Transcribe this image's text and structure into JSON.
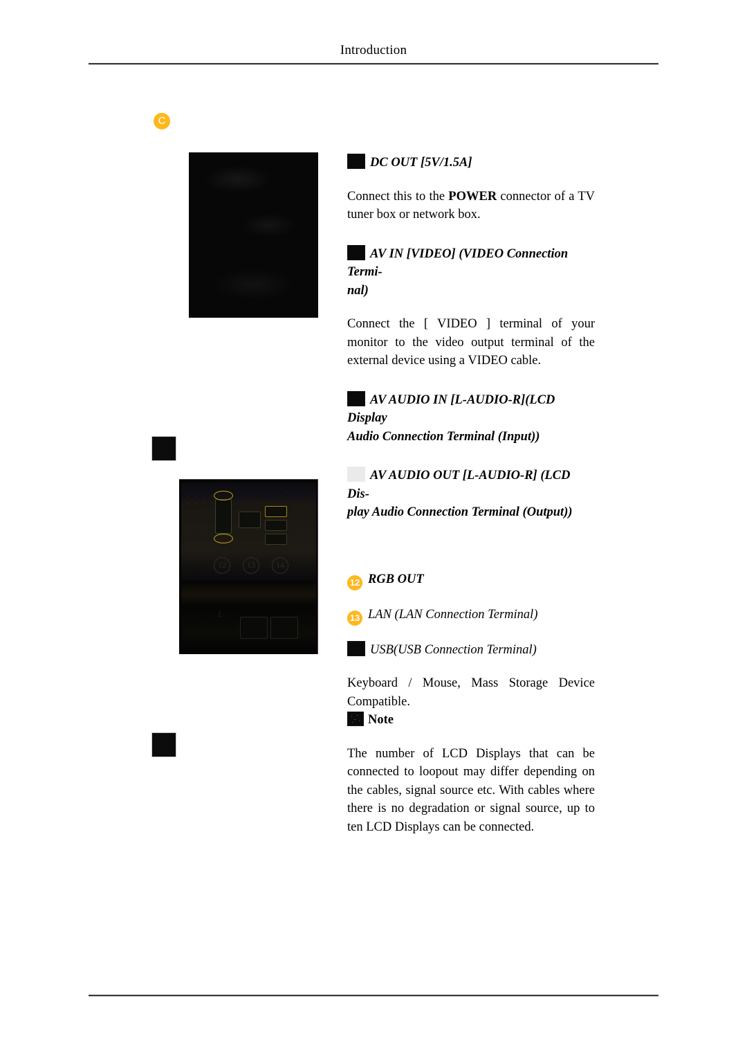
{
  "header": {
    "running_head": "Introduction"
  },
  "section_marker": {
    "letter": "C",
    "color": "#ffb81c"
  },
  "figures": {
    "top_photo": {
      "name": "connector-panel-photo-upper",
      "description": "dark photograph of monitor rear connector panel"
    },
    "bottom_photo": {
      "name": "connector-panel-photo-lower",
      "description": "dark photograph of connector panel with callouts",
      "callouts": [
        "12",
        "13",
        "14"
      ]
    },
    "margin_squares": [
      {
        "name": "margin-thumb-upper"
      },
      {
        "name": "margin-thumb-lower"
      }
    ]
  },
  "entries": [
    {
      "id": "dc-out",
      "badge_type": "square-dark",
      "badge_text": "",
      "heading": "DC OUT [5V/1.5A]",
      "body_pre": "Connect this to the ",
      "body_strong": "POWER",
      "body_post": " connector of a TV tuner box or network box."
    },
    {
      "id": "av-in-video",
      "badge_type": "square-dark",
      "badge_text": "",
      "heading": "AV IN [VIDEO] (VIDEO Connection Termi-",
      "heading_cont": "nal)",
      "body": "Connect the [ VIDEO ] terminal of your monitor to the video output terminal of the external device using a VIDEO cable."
    },
    {
      "id": "av-audio-in",
      "badge_type": "square-dark",
      "badge_text": "",
      "heading": "AV AUDIO IN [L-AUDIO-R](LCD Display",
      "heading_cont": "Audio Connection Terminal (Input))"
    },
    {
      "id": "av-audio-out",
      "badge_type": "square-light",
      "badge_text": "",
      "heading": "AV AUDIO OUT [L-AUDIO-R] (LCD Dis-",
      "heading_cont": "play Audio Connection Terminal (Output))"
    },
    {
      "id": "rgb-out",
      "badge_type": "circle-orange",
      "badge_text": "12",
      "heading": "RGB OUT"
    },
    {
      "id": "lan",
      "badge_type": "circle-orange",
      "badge_text": "13",
      "heading": "LAN (LAN Connection Terminal)"
    },
    {
      "id": "usb",
      "badge_type": "square-dark",
      "badge_text": "",
      "heading": "USB(USB Connection Terminal)",
      "body": "Keyboard / Mouse, Mass Storage Device Compatible."
    }
  ],
  "note": {
    "label": "Note",
    "body": "The number of LCD Displays that can be connected to loopout may differ depending on the cables, signal source etc. With cables where there is no degradation or signal source, up to ten LCD Displays can be connected."
  }
}
